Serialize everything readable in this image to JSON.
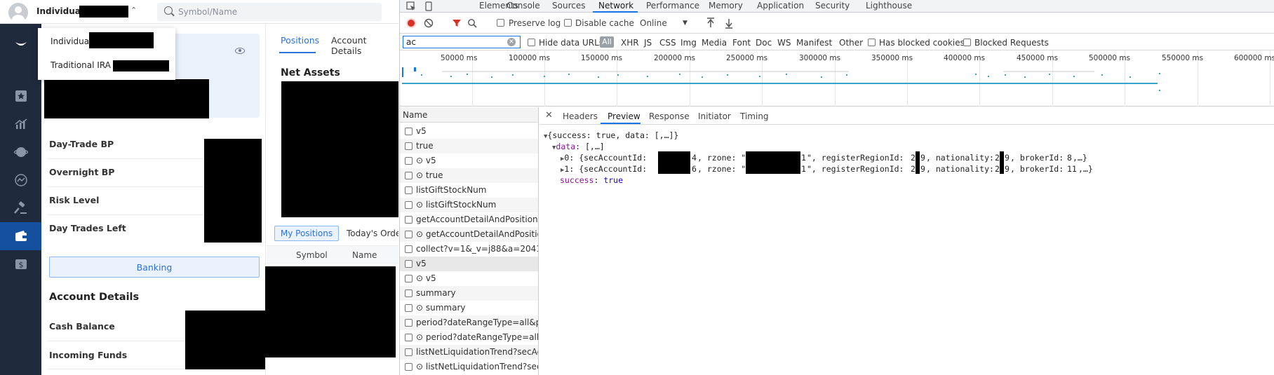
{
  "app": {
    "topbar": {
      "account_name": "Individual",
      "search_placeholder": "Symbol/Name"
    },
    "account_dropdown": {
      "items": [
        "Individua",
        "Traditional IRA"
      ]
    },
    "summary_rows": [
      "Day-Trade BP",
      "Overnight BP",
      "Risk Level",
      "Day Trades Left"
    ],
    "banking_label": "Banking",
    "account_details_title": "Account Details",
    "account_detail_rows": [
      "Cash Balance",
      "Incoming Funds"
    ],
    "main_tabs": [
      "Positions",
      "Account Details"
    ],
    "net_assets_title": "Net Assets",
    "positions_subtabs": [
      "My Positions",
      "Today's Orde"
    ],
    "positions_columns": [
      "Symbol",
      "Name"
    ],
    "nav_icons": [
      "logo-icon",
      "watchlist-star-icon",
      "markets-chart-icon",
      "globe-icon",
      "trend-icon",
      "auction-gavel-icon",
      "wallet-icon",
      "dollar-icon"
    ],
    "colors": {
      "nav_bg": "#1f2a3d",
      "nav_active": "#14509d",
      "accent": "#2b72d9"
    }
  },
  "devtools": {
    "tabs": [
      "Elements",
      "Console",
      "Sources",
      "Network",
      "Performance",
      "Memory",
      "Application",
      "Security",
      "Lighthouse"
    ],
    "active_tab": "Network",
    "toolbar": {
      "preserve_log": "Preserve log",
      "disable_cache": "Disable cache",
      "throttle": "Online"
    },
    "filter": {
      "value": "ac",
      "hide_data_urls": "Hide data URLs",
      "types": [
        "All",
        "XHR",
        "JS",
        "CSS",
        "Img",
        "Media",
        "Font",
        "Doc",
        "WS",
        "Manifest",
        "Other"
      ],
      "has_blocked_cookies": "Has blocked cookies",
      "blocked_requests": "Blocked Requests"
    },
    "timeline_ticks": [
      "50000 ms",
      "100000 ms",
      "150000 ms",
      "200000 ms",
      "250000 ms",
      "300000 ms",
      "350000 ms",
      "400000 ms",
      "450000 ms",
      "500000 ms",
      "550000 ms",
      "600000 ms"
    ],
    "name_header": "Name",
    "requests": [
      "v5",
      "true",
      "⊙ v5",
      "⊙ true",
      "listGiftStockNum",
      "⊙ listGiftStockNum",
      "getAccountDetailAndPosition",
      "⊙ getAccountDetailAndPosition",
      "collect?v=1&_v=j88&a=20419...",
      "v5",
      "⊙ v5",
      "summary",
      "⊙ summary",
      "period?dateRangeType=all&p...",
      "⊙ period?dateRangeType=all...",
      "listNetLiquidationTrend?secAc...",
      "⊙ listNetLiquidationTrend?sec..."
    ],
    "detail_tabs": [
      "Headers",
      "Preview",
      "Response",
      "Initiator",
      "Timing"
    ],
    "active_detail_tab": "Preview",
    "preview": {
      "root": "{success: true, data: [,…]}",
      "data_key": "data",
      "data_summary": "[,…]",
      "item0_prefix": "0: {secAccountId: ",
      "item0_id_tail": "4",
      "item0_rzone_tail": "1",
      "item0_reg_a": "2",
      "item0_reg_b": "9",
      "item0_nat_a": "2",
      "item0_nat_b": "9",
      "item0_broker": "8",
      "item1_prefix": "1: {secAccountId: ",
      "item1_id_tail": "6",
      "item1_rzone_tail": "1",
      "item1_reg_a": "2",
      "item1_reg_b": "9",
      "item1_nat_a": "2",
      "item1_nat_b": "9",
      "item1_broker": "11",
      "success_key": "success",
      "success_value": "true"
    }
  }
}
